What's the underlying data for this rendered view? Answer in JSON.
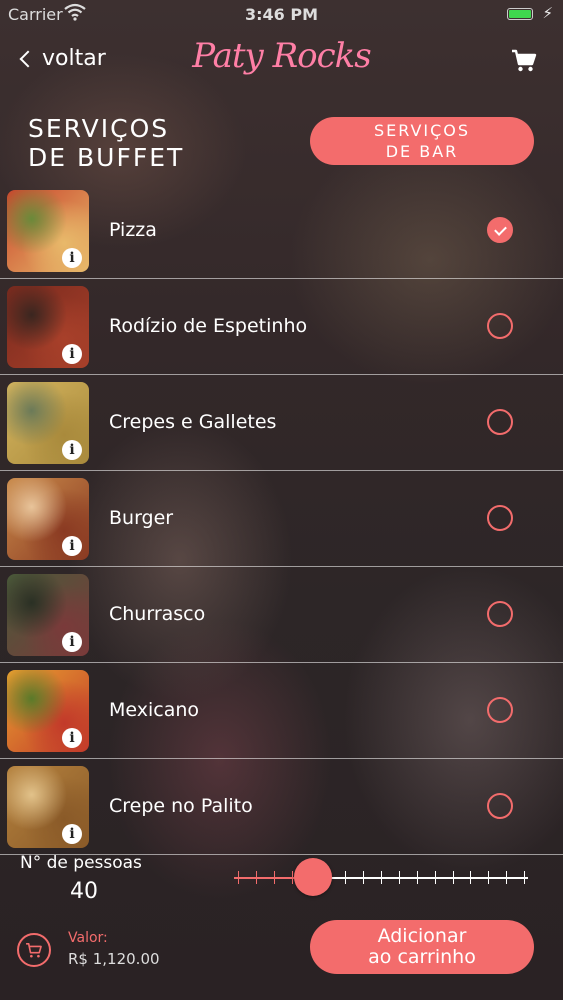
{
  "status_bar": {
    "carrier": "Carrier",
    "time": "3:46 PM",
    "battery_level": 1.0
  },
  "nav": {
    "back_label": "voltar",
    "logo_text": "Paty Rocks",
    "cart_icon": "cart-icon"
  },
  "page": {
    "title": "SERVIÇOS\nDE BUFFET",
    "bar_button": "SERVIÇOS\nDE BAR"
  },
  "services": [
    {
      "label": "Pizza",
      "selected": true,
      "thumb_colors": [
        "#c9462d",
        "#e8b96a",
        "#6a8a3a"
      ]
    },
    {
      "label": "Rodízio de Espetinho",
      "selected": false,
      "thumb_colors": [
        "#7a2a1e",
        "#a8402a",
        "#3a2620"
      ]
    },
    {
      "label": "Crepes e Galletes",
      "selected": false,
      "thumb_colors": [
        "#d4b45e",
        "#a98a3c",
        "#6b7a58"
      ]
    },
    {
      "label": "Burger",
      "selected": false,
      "thumb_colors": [
        "#c98a4a",
        "#8a3a22",
        "#e8c49a"
      ]
    },
    {
      "label": "Churrasco",
      "selected": false,
      "thumb_colors": [
        "#4a5a3a",
        "#7a3a3a",
        "#2a3024"
      ]
    },
    {
      "label": "Mexicano",
      "selected": false,
      "thumb_colors": [
        "#e8a030",
        "#c23a2a",
        "#5a7a2a"
      ]
    },
    {
      "label": "Crepe no Palito",
      "selected": false,
      "thumb_colors": [
        "#b5823e",
        "#8a5a28",
        "#e2c28a"
      ]
    }
  ],
  "people": {
    "label": "N° de pessoas",
    "value": "40",
    "slider_fraction": 0.27,
    "tick_count": 17
  },
  "footer": {
    "valor_label": "Valor:",
    "valor_amount": "R$ 1,120.00",
    "add_button": "Adicionar\nao carrinho"
  },
  "colors": {
    "accent": "#f36c6c",
    "logo": "#ff7fa6",
    "battery": "#3fd84e"
  }
}
